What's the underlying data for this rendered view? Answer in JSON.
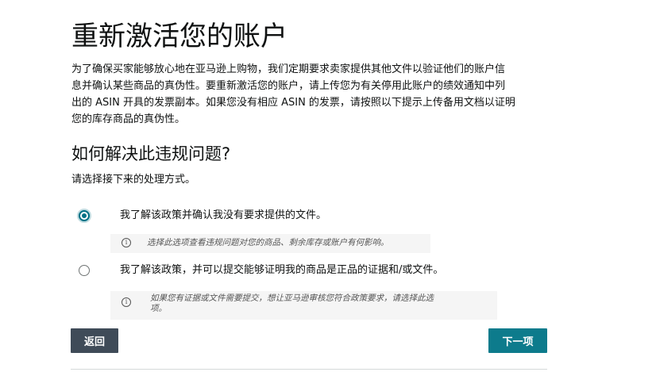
{
  "page": {
    "title": "重新激活您的账户",
    "intro_lines": [
      "为了确保买家能够放心地在亚马逊上购物，我们定期要求卖家提供其他文件以验证他们的账户信",
      "息并确认某些商品的真伪性。要重新激活您的账户，请上传您为有关停用此账户的绩效通知中列",
      "出的 ASIN 开具的发票副本。如果您没有相应 ASIN 的发票，请按照以下提示上传备用文档以证明",
      "您的库存商品的真伪性。"
    ],
    "section_heading": "如何解决此违规问题?",
    "prompt": "请选择接下来的处理方式。"
  },
  "options": [
    {
      "label": "我了解该政策并确认我没有要求提供的文件。",
      "selected": true,
      "hint_lines": [
        "选择此选项查看违规问题对您的商品、剩余库存或账户有何影响。"
      ]
    },
    {
      "label": "我了解该政策，并可以提交能够证明我的商品是正品的证据和/或文件。",
      "selected": false,
      "hint_lines": [
        "如果您有证据或文件需要提交，想让亚马逊审核您符合政策要求，请选择此选",
        "项。"
      ]
    }
  ],
  "buttons": {
    "back": "返回",
    "next": "下一项"
  },
  "icons": {
    "hint": "info-icon",
    "hint_glyph": "i"
  },
  "colors": {
    "accent": "#007185",
    "back_button": "#3f4b58",
    "next_button": "#0d7b8c"
  }
}
